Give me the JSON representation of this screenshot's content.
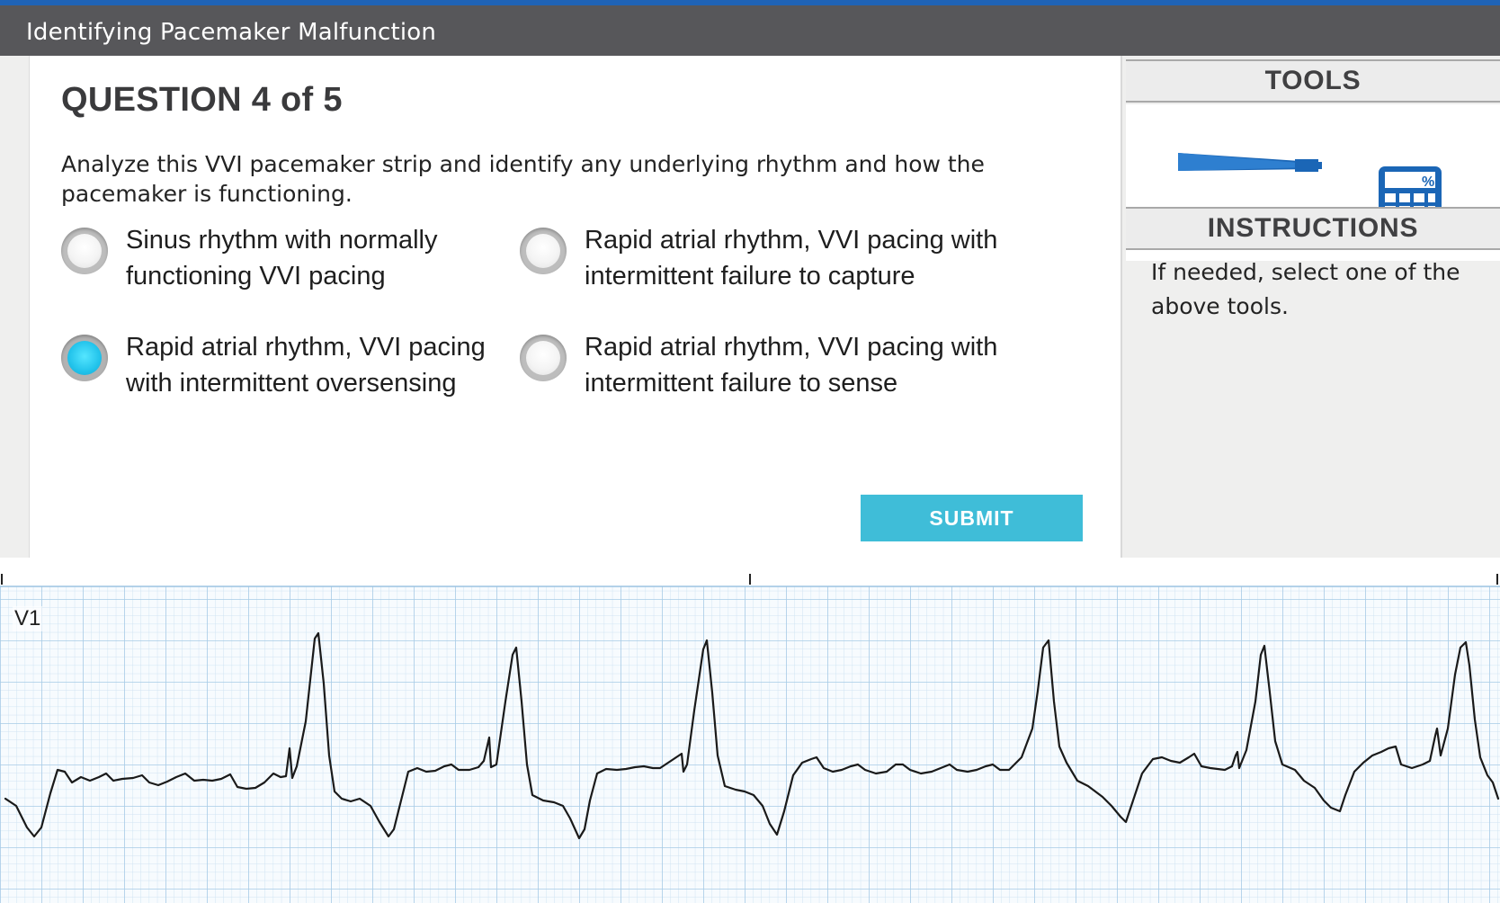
{
  "header": {
    "title": "Identifying Pacemaker Malfunction"
  },
  "question": {
    "heading": "QUESTION 4 of 5",
    "text": "Analyze this VVI pacemaker strip and identify any underlying rhythm and how the pacemaker is functioning.",
    "options": [
      {
        "line1": "Sinus rhythm with normally",
        "line2": "functioning VVI pacing",
        "selected": false
      },
      {
        "line1": "Rapid atrial rhythm, VVI pacing with",
        "line2": "intermittent failure to capture",
        "selected": false
      },
      {
        "line1": "Rapid atrial rhythm, VVI pacing",
        "line2": "with intermittent oversensing",
        "selected": true
      },
      {
        "line1": "Rapid atrial rhythm, VVI pacing with",
        "line2": "intermittent failure to sense",
        "selected": false
      }
    ],
    "submit_label": "SUBMIT"
  },
  "sidebar": {
    "tools_heading": "TOOLS",
    "tools": [
      {
        "name": "calipers",
        "icon": "caliper-icon"
      },
      {
        "name": "calculator",
        "icon": "calculator-icon"
      }
    ],
    "instructions_heading": "INSTRUCTIONS",
    "instructions_text": "If needed, select one of the above tools."
  },
  "ecg": {
    "lead": "V1"
  },
  "colors": {
    "topbar": "#57575a",
    "topbar_accent": "#1f63b6",
    "submit": "#3fbdd8",
    "radio_selected": "#22c3eb",
    "tool_blue": "#1b66b6",
    "grid_minor": "#cfe3f2",
    "grid_major": "#a7cbe6"
  }
}
